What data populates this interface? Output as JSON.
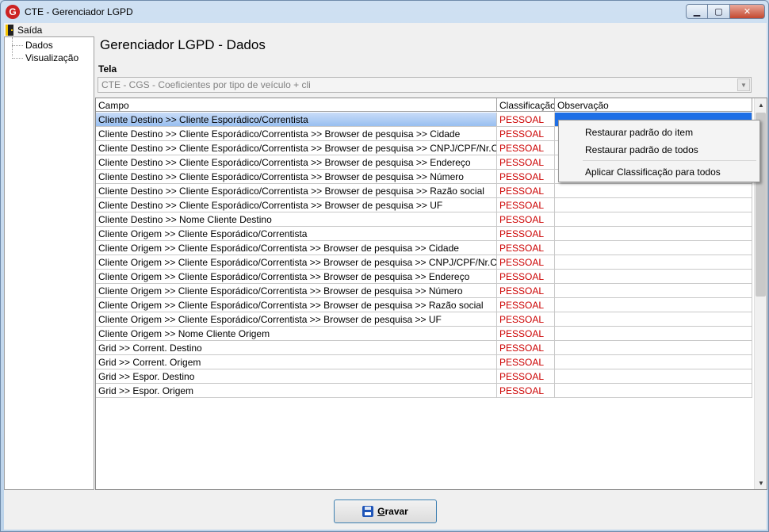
{
  "window": {
    "title": "CTE - Gerenciador LGPD",
    "app_icon": "G",
    "buttons": {
      "minimize": "▁",
      "maximize": "▢",
      "close": "✕"
    }
  },
  "menu": {
    "exit_label": "Saída"
  },
  "tree": {
    "items": [
      "Dados",
      "Visualização"
    ]
  },
  "page": {
    "title": "Gerenciador LGPD - Dados",
    "tela_label": "Tela",
    "tela_value": "CTE - CGS - Coeficientes por tipo de veículo + cli"
  },
  "grid": {
    "headers": [
      "Campo",
      "Classificação",
      "Observação"
    ],
    "rows": [
      {
        "campo": "Cliente Destino >> Cliente Esporádico/Correntista",
        "classificacao": "PESSOAL",
        "observacao": ""
      },
      {
        "campo": "Cliente Destino >> Cliente Esporádico/Correntista >> Browser de pesquisa >> Cidade",
        "classificacao": "PESSOAL",
        "observacao": ""
      },
      {
        "campo": "Cliente Destino >> Cliente Esporádico/Correntista >> Browser de pesquisa >> CNPJ/CPF/Nr.Cliente",
        "classificacao": "PESSOAL",
        "observacao": ""
      },
      {
        "campo": "Cliente Destino >> Cliente Esporádico/Correntista >> Browser de pesquisa >> Endereço",
        "classificacao": "PESSOAL",
        "observacao": ""
      },
      {
        "campo": "Cliente Destino >> Cliente Esporádico/Correntista >> Browser de pesquisa >> Número",
        "classificacao": "PESSOAL",
        "observacao": ""
      },
      {
        "campo": "Cliente Destino >> Cliente Esporádico/Correntista >> Browser de pesquisa >> Razão social",
        "classificacao": "PESSOAL",
        "observacao": ""
      },
      {
        "campo": "Cliente Destino >> Cliente Esporádico/Correntista >> Browser de pesquisa >> UF",
        "classificacao": "PESSOAL",
        "observacao": ""
      },
      {
        "campo": "Cliente Destino >> Nome Cliente Destino",
        "classificacao": "PESSOAL",
        "observacao": ""
      },
      {
        "campo": "Cliente Origem >> Cliente Esporádico/Correntista",
        "classificacao": "PESSOAL",
        "observacao": ""
      },
      {
        "campo": "Cliente Origem >> Cliente Esporádico/Correntista >> Browser de pesquisa >> Cidade",
        "classificacao": "PESSOAL",
        "observacao": ""
      },
      {
        "campo": "Cliente Origem >> Cliente Esporádico/Correntista >> Browser de pesquisa >> CNPJ/CPF/Nr.Cliente",
        "classificacao": "PESSOAL",
        "observacao": ""
      },
      {
        "campo": "Cliente Origem >> Cliente Esporádico/Correntista >> Browser de pesquisa >> Endereço",
        "classificacao": "PESSOAL",
        "observacao": ""
      },
      {
        "campo": "Cliente Origem >> Cliente Esporádico/Correntista >> Browser de pesquisa >> Número",
        "classificacao": "PESSOAL",
        "observacao": ""
      },
      {
        "campo": "Cliente Origem >> Cliente Esporádico/Correntista >> Browser de pesquisa >> Razão social",
        "classificacao": "PESSOAL",
        "observacao": ""
      },
      {
        "campo": "Cliente Origem >> Cliente Esporádico/Correntista >> Browser de pesquisa >> UF",
        "classificacao": "PESSOAL",
        "observacao": ""
      },
      {
        "campo": "Cliente Origem >> Nome Cliente Origem",
        "classificacao": "PESSOAL",
        "observacao": ""
      },
      {
        "campo": "Grid >> Corrent. Destino",
        "classificacao": "PESSOAL",
        "observacao": ""
      },
      {
        "campo": "Grid >> Corrent. Origem",
        "classificacao": "PESSOAL",
        "observacao": ""
      },
      {
        "campo": "Grid >> Espor. Destino",
        "classificacao": "PESSOAL",
        "observacao": ""
      },
      {
        "campo": "Grid >> Espor. Origem",
        "classificacao": "PESSOAL",
        "observacao": ""
      }
    ],
    "selected_row": 0
  },
  "context_menu": {
    "items": [
      "Restaurar padrão do item",
      "Restaurar padrão de todos",
      "Aplicar Classificação para todos"
    ]
  },
  "save_button": {
    "accel": "G",
    "rest": "ravar"
  },
  "colors": {
    "classification": "#cc0000",
    "selection": "#1e6fe6",
    "accent_border": "#3c7fb1"
  }
}
